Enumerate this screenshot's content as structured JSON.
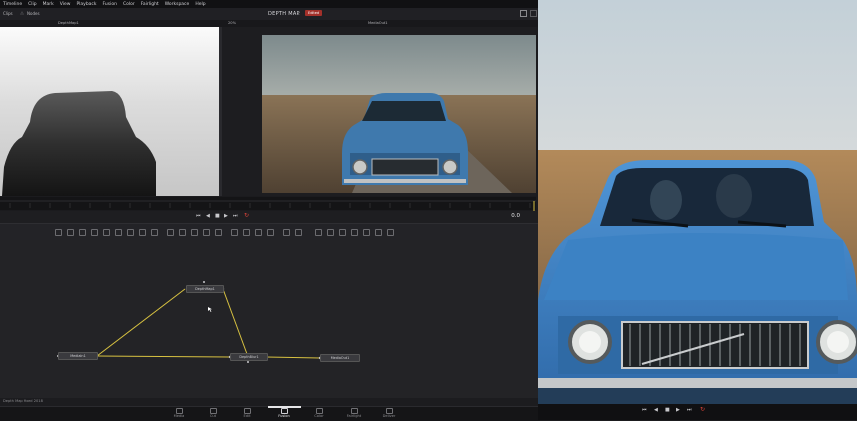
{
  "menu": [
    "Timeline",
    "Clip",
    "Mark",
    "View",
    "Playback",
    "Fusion",
    "Color",
    "Fairlight",
    "Workspace",
    "Help"
  ],
  "toolbar": {
    "clips_label": "Clips",
    "nodes_label": "Nodes",
    "project_title": "DEPTH MAP",
    "badge": "Edited",
    "zoom_left": "20%",
    "zoom_right": "20%"
  },
  "viewers": {
    "left_title": "DepthMap1",
    "right_title": "MediaOut1",
    "right_subtitle": "Fusion default"
  },
  "transport": {
    "timecode": "0.0"
  },
  "nodes": {
    "items": [
      {
        "label": "MediaIn1"
      },
      {
        "label": "DepthMap1"
      },
      {
        "label": "DepthBlur1"
      },
      {
        "label": "MediaOut1"
      }
    ]
  },
  "status": {
    "text": "Depth Map fixed 2018"
  },
  "pages": [
    {
      "label": "Media",
      "active": false
    },
    {
      "label": "Cut",
      "active": false
    },
    {
      "label": "Edit",
      "active": false
    },
    {
      "label": "Fusion",
      "active": true
    },
    {
      "label": "Color",
      "active": false
    },
    {
      "label": "Fairlight",
      "active": false
    },
    {
      "label": "Deliver",
      "active": false
    }
  ],
  "colors": {
    "accent_red": "#e0453a",
    "node_link": "#d8c241",
    "blue_car": "#3d7fbd"
  }
}
